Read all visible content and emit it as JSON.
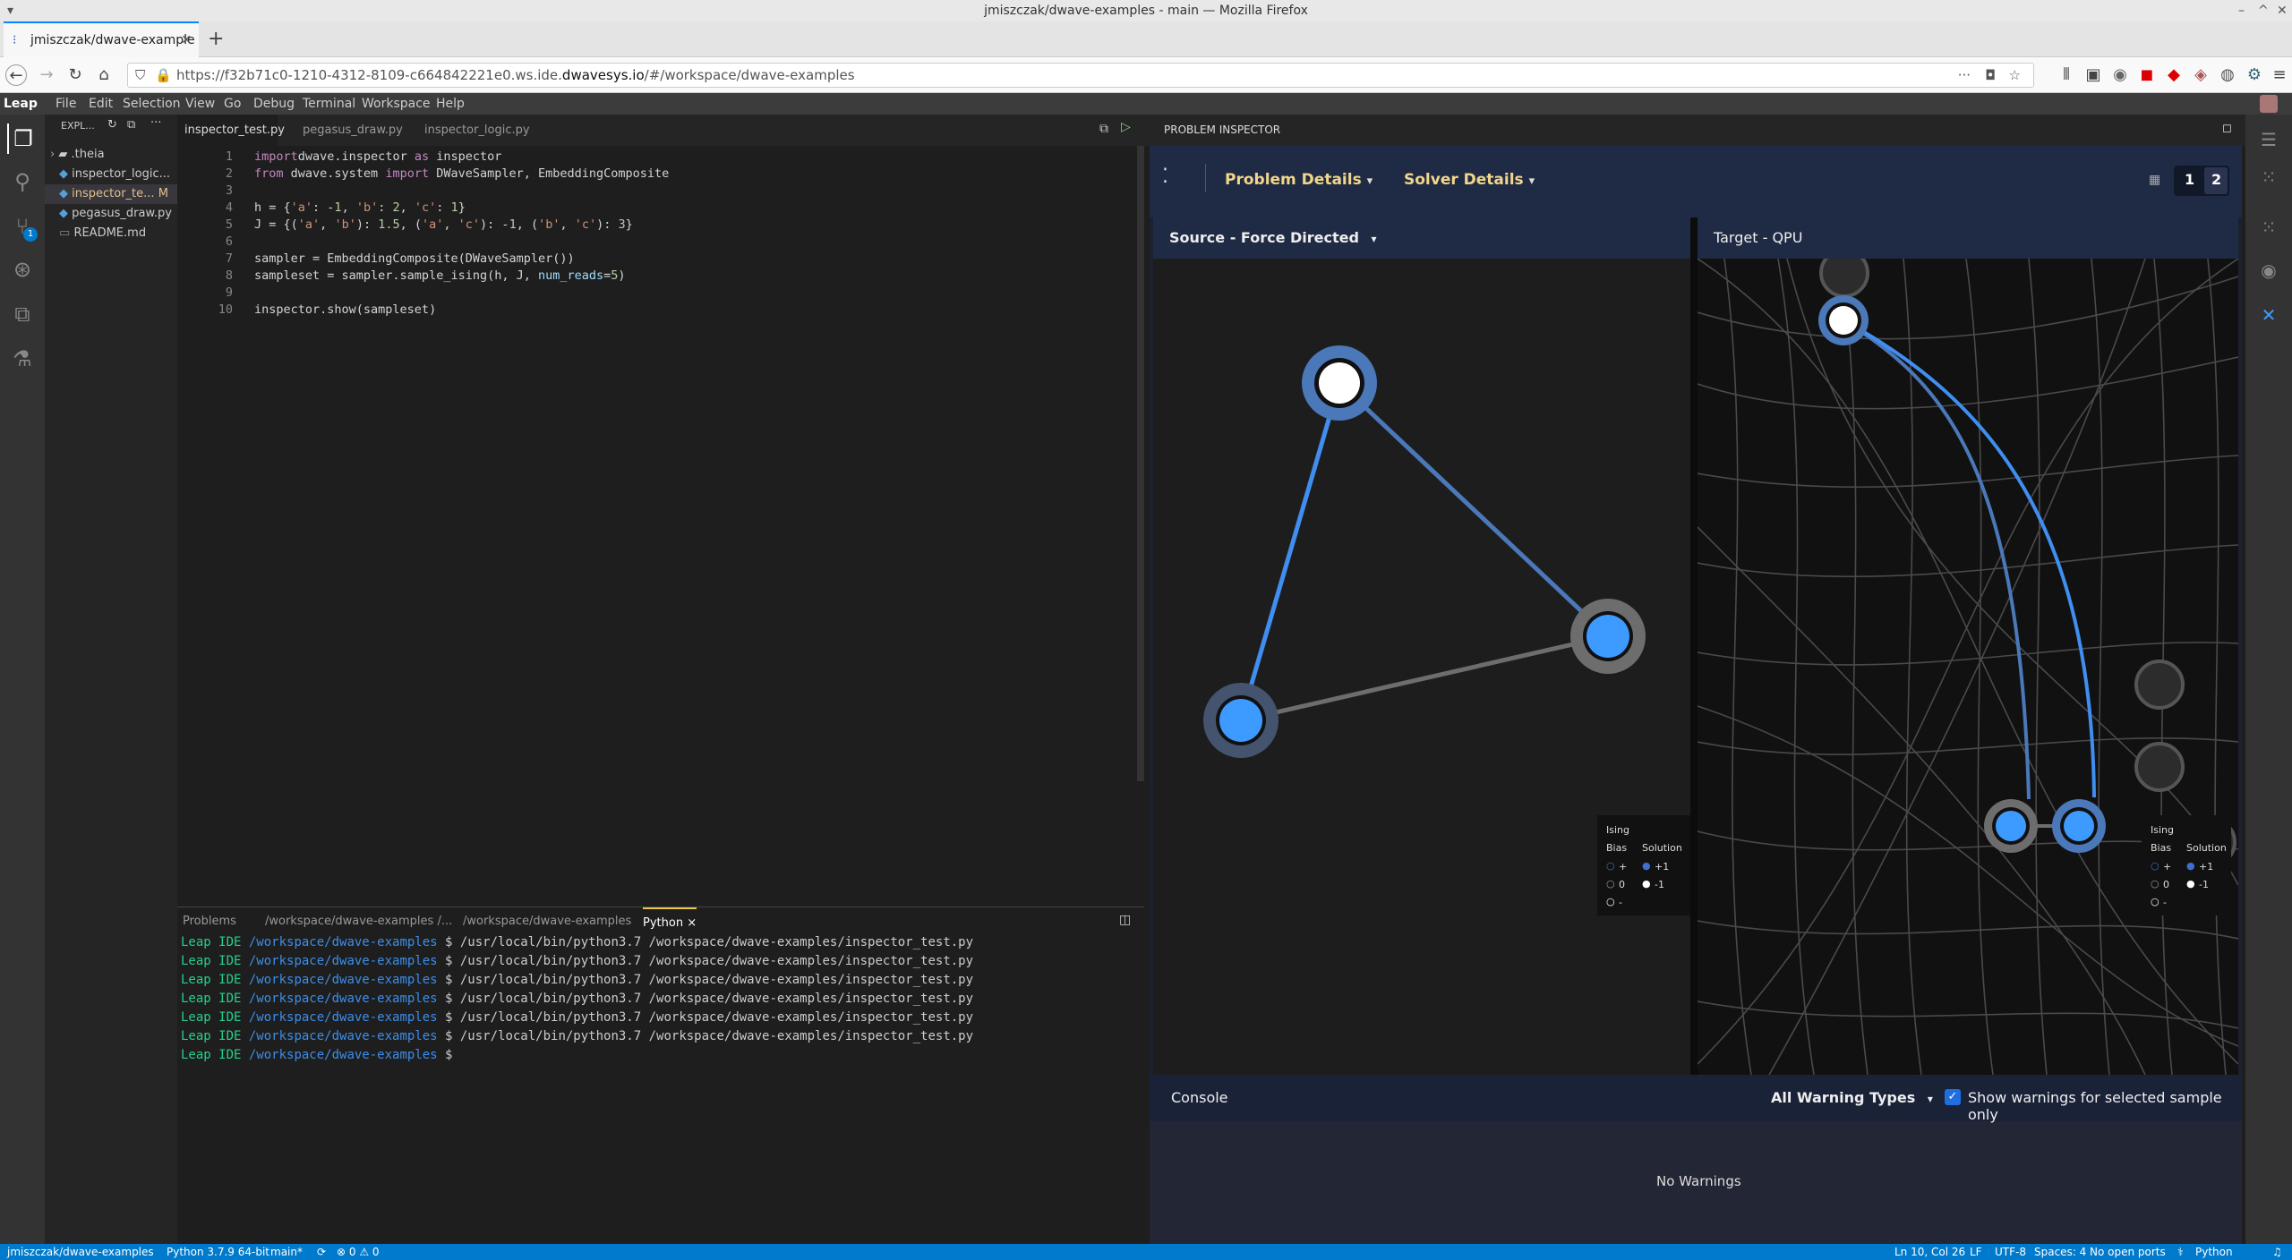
{
  "window": {
    "title": "jmiszczak/dwave-examples - main — Mozilla Firefox"
  },
  "browser": {
    "tab_title": "jmiszczak/dwave-example",
    "url_prefix": "https://f32b71c0-1210-4312-8109-c664842221e0.ws.ide.",
    "url_domain": "dwavesys.io",
    "url_suffix": "/#/workspace/dwave-examples",
    "new_tab": "+"
  },
  "menu": {
    "logo": "Leap",
    "items": [
      "File",
      "Edit",
      "Selection",
      "View",
      "Go",
      "Debug",
      "Terminal",
      "Workspace",
      "Help"
    ]
  },
  "explorer": {
    "title": "EXPL...",
    "items": [
      {
        "label": ".theia"
      },
      {
        "label": "inspector_logic..."
      },
      {
        "label": "inspector_te...",
        "badge": "M"
      },
      {
        "label": "pegasus_draw.py"
      },
      {
        "label": "README.md"
      }
    ]
  },
  "editor": {
    "tabs": [
      "inspector_test.py",
      "pegasus_draw.py",
      "inspector_logic.py"
    ],
    "lines": [
      {
        "n": "1",
        "segs": [
          [
            "kw",
            "import"
          ],
          [
            "",
            "dwave.inspector "
          ],
          [
            "kw",
            "as"
          ],
          [
            "",
            " inspector"
          ]
        ]
      },
      {
        "n": "2",
        "segs": [
          [
            "kw",
            "from"
          ],
          [
            "",
            " dwave.system "
          ],
          [
            "kw",
            "import"
          ],
          [
            "",
            " DWaveSampler, EmbeddingComposite"
          ]
        ]
      },
      {
        "n": "3",
        "segs": []
      },
      {
        "n": "4",
        "segs": [
          [
            "",
            "h = {"
          ],
          [
            "str",
            "'a'"
          ],
          [
            "",
            ": -"
          ],
          [
            "num",
            "1"
          ],
          [
            "",
            ", "
          ],
          [
            "str",
            "'b'"
          ],
          [
            "",
            ": "
          ],
          [
            "num",
            "2"
          ],
          [
            "",
            ", "
          ],
          [
            "str",
            "'c'"
          ],
          [
            "",
            ": "
          ],
          [
            "num",
            "1"
          ],
          [
            "",
            "}"
          ]
        ]
      },
      {
        "n": "5",
        "segs": [
          [
            "",
            "J = {("
          ],
          [
            "str",
            "'a'"
          ],
          [
            "",
            ", "
          ],
          [
            "str",
            "'b'"
          ],
          [
            "",
            "): "
          ],
          [
            "num",
            "1.5"
          ],
          [
            "",
            ", ("
          ],
          [
            "str",
            "'a'"
          ],
          [
            "",
            ", "
          ],
          [
            "str",
            "'c'"
          ],
          [
            "",
            "): -"
          ],
          [
            "num",
            "1"
          ],
          [
            "",
            ", ("
          ],
          [
            "str",
            "'b'"
          ],
          [
            "",
            ", "
          ],
          [
            "str",
            "'c'"
          ],
          [
            "",
            "): "
          ],
          [
            "num",
            "3"
          ],
          [
            "",
            "}"
          ]
        ]
      },
      {
        "n": "6",
        "segs": []
      },
      {
        "n": "7",
        "segs": [
          [
            "",
            "sampler = EmbeddingComposite(DWaveSampler())"
          ]
        ]
      },
      {
        "n": "8",
        "segs": [
          [
            "",
            "sampleset = sampler.sample_ising(h, J, "
          ],
          [
            "var",
            "num_reads"
          ],
          [
            "",
            "="
          ],
          [
            "num",
            "5"
          ],
          [
            "",
            ")"
          ]
        ]
      },
      {
        "n": "9",
        "segs": []
      },
      {
        "n": "10",
        "segs": [
          [
            "",
            "inspector.show(sampleset)"
          ]
        ]
      }
    ]
  },
  "panel": {
    "tabs": [
      "Problems",
      "/workspace/dwave-examples /...",
      "/workspace/dwave-examples",
      "Python"
    ],
    "close": "×",
    "terminal_lines": [
      {
        "prompt": "Leap IDE",
        "path": "/workspace/dwave-examples",
        "cmd": " $ /usr/local/bin/python3.7 /workspace/dwave-examples/inspector_test.py"
      },
      {
        "prompt": "Leap IDE",
        "path": "/workspace/dwave-examples",
        "cmd": " $ /usr/local/bin/python3.7 /workspace/dwave-examples/inspector_test.py"
      },
      {
        "prompt": "Leap IDE",
        "path": "/workspace/dwave-examples",
        "cmd": " $ /usr/local/bin/python3.7 /workspace/dwave-examples/inspector_test.py"
      },
      {
        "prompt": "Leap IDE",
        "path": "/workspace/dwave-examples",
        "cmd": " $ /usr/local/bin/python3.7 /workspace/dwave-examples/inspector_test.py"
      },
      {
        "prompt": "Leap IDE",
        "path": "/workspace/dwave-examples",
        "cmd": " $ /usr/local/bin/python3.7 /workspace/dwave-examples/inspector_test.py"
      },
      {
        "prompt": "Leap IDE",
        "path": "/workspace/dwave-examples",
        "cmd": " $ /usr/local/bin/python3.7 /workspace/dwave-examples/inspector_test.py"
      },
      {
        "prompt": "Leap IDE",
        "path": "/workspace/dwave-examples",
        "cmd": " $ "
      }
    ]
  },
  "inspector": {
    "header": "PROBLEM INSPECTOR",
    "problem_details": "Problem Details",
    "solver_details": "Solver Details",
    "sample_1": "1",
    "sample_2": "2",
    "source_title": "Source - Force Directed",
    "target_title": "Target - QPU",
    "legend": {
      "title": "Ising",
      "bias": "Bias",
      "solution": "Solution",
      "plus": "+",
      "zero": "0",
      "minus": "-",
      "sol_plus": "+1",
      "sol_minus": "-1"
    },
    "console": {
      "title": "Console",
      "filter": "All Warning Types",
      "checkbox_label": "Show warnings for selected sample only",
      "empty": "No Warnings"
    }
  },
  "statusbar": {
    "repo": "jmiszczak/dwave-examples",
    "python": "Python 3.7.9 64-bit",
    "branch": "main*",
    "sync": "⟳",
    "problems": "⊗ 0 ⚠ 0",
    "position": "Ln 10, Col 26",
    "eol": "LF",
    "encoding": "UTF-8",
    "spaces": "Spaces: 4",
    "ports": "No open ports",
    "language": "Python"
  },
  "colors": {
    "accent": "#007acc",
    "gold": "#f2d68a",
    "node_blue": "#3d9bff",
    "edge_blue": "#4b8fe8"
  }
}
